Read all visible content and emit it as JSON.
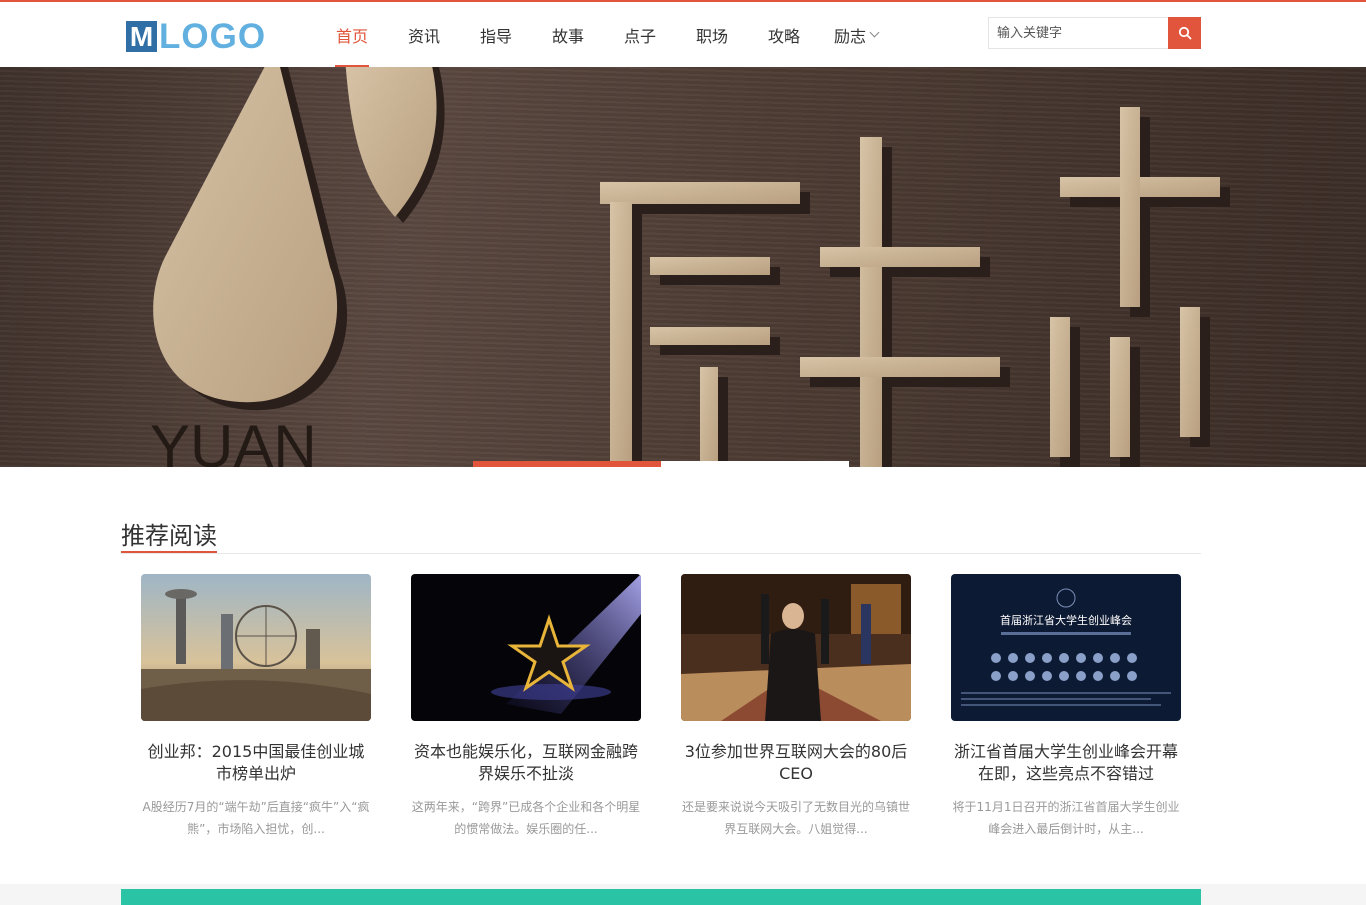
{
  "header": {
    "logo": {
      "letter": "M",
      "rest": "LOGO"
    },
    "nav": [
      {
        "label": "首页",
        "active": true
      },
      {
        "label": "资讯"
      },
      {
        "label": "指导"
      },
      {
        "label": "故事"
      },
      {
        "label": "点子"
      },
      {
        "label": "职场"
      },
      {
        "label": "攻略"
      },
      {
        "label": "励志",
        "dropdown": true
      }
    ],
    "search": {
      "placeholder": "输入关键字",
      "button_icon": "search-icon"
    }
  },
  "banner": {
    "brand_text": "愿生态",
    "brand_sub": "YUAN",
    "slides": 2,
    "active_slide": 1
  },
  "recommend": {
    "title": "推荐阅读",
    "articles": [
      {
        "title": "创业邦：2015中国最佳创业城市榜单出炉",
        "summary": "A股经历7月的“端午劫”后直接“疯牛”入“疯熊”，市场陷入担忧，创..."
      },
      {
        "title": "资本也能娱乐化，互联网金融跨界娱乐不扯淡",
        "summary": "这两年来，“跨界”已成各个企业和各个明星的惯常做法。娱乐圈的任..."
      },
      {
        "title": "3位参加世界互联网大会的80后CEO",
        "summary": "还是要来说说今天吸引了无数目光的乌镇世界互联网大会。八姐觉得..."
      },
      {
        "title": "浙江省首届大学生创业峰会开幕在即，这些亮点不容错过",
        "summary": "将于11月1日召开的浙江省首届大学生创业峰会进入最后倒计时，从主...",
        "poster_title": "首届浙江省大学生创业峰会"
      }
    ]
  },
  "colors": {
    "accent": "#e0553b",
    "logo_blue": "#2f6fa6",
    "logo_light": "#62b0e0",
    "footer_teal": "#2bc3a5"
  }
}
